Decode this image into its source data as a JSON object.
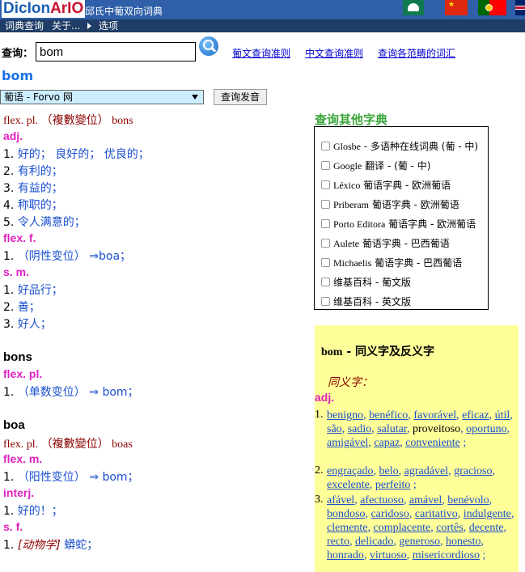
{
  "header": {
    "logo_a": "DicIon",
    "logo_b": "ArIO",
    "site_title": "邱氏中葡双向词典",
    "flags": [
      "macau-flag-icon",
      "china-flag-icon",
      "portugal-flag-icon",
      "uk-flag-icon"
    ],
    "colors": {
      "topbar": "#2e5fa8",
      "menubar": "#1f3d66"
    }
  },
  "menu": {
    "item1": "词典查询",
    "item2": "关于...",
    "item3": "选项"
  },
  "search": {
    "label": "查询：",
    "value": "bom",
    "button_icon": "search-icon",
    "links": [
      "葡文查询准则",
      "中文查询准则",
      "查询各范畴的词汇"
    ]
  },
  "headword": "bom",
  "voice": {
    "select_value": "葡语 - Forvo 网",
    "button": "查询发音"
  },
  "entry1": {
    "flex_pl": "flex. pl.",
    "flex_cn": "（複數變位）",
    "flex_word": "bons",
    "adj": "adj.",
    "adj_senses": [
      {
        "n": "1. ",
        "t": "好的； 良好的； 优良的；"
      },
      {
        "n": "2. ",
        "t": "有利的；"
      },
      {
        "n": "3. ",
        "t": "有益的；"
      },
      {
        "n": "4. ",
        "t": "称职的；"
      },
      {
        "n": "5. ",
        "t": "令人满意的；"
      }
    ],
    "flex_f": "flex. f.",
    "flex_f_sense": {
      "n": "1. ",
      "t": "（阴性变位） ⇒boa；"
    },
    "sm": "s. m.",
    "sm_senses": [
      {
        "n": "1. ",
        "t": "好品行；"
      },
      {
        "n": "2. ",
        "t": "善；"
      },
      {
        "n": "3. ",
        "t": "好人；"
      }
    ]
  },
  "entry2": {
    "word": "bons",
    "pos": "flex. pl.",
    "sense": {
      "n": "1. ",
      "t": "（单数变位） ⇒ bom；"
    }
  },
  "entry3": {
    "word": "boa",
    "flex_pl": "flex. pl.",
    "flex_cn": "（複數變位）",
    "flex_word": "boas",
    "flex_m": "flex. m.",
    "flex_m_sense": {
      "n": "1. ",
      "t": "（阳性变位） ⇒ bom；"
    },
    "interj": "interj.",
    "interj_sense": {
      "n": "1. ",
      "t": "好的！；"
    },
    "sf": "s. f.",
    "sf_sense": {
      "n": "1. ",
      "em": "[动物学]",
      "t": " 蟒蛇；"
    }
  },
  "other_dicts": {
    "title": "查询其他字典",
    "items": [
      {
        "lt": "Glosbe",
        "cn": " - 多语种在线词典 (葡 - 中)"
      },
      {
        "lt": "Google",
        "cn": " 翻译 - (葡 - 中)"
      },
      {
        "lt": "Léxico",
        "cn": " 葡语字典 - 欧洲葡语"
      },
      {
        "lt": "Priberam",
        "cn": " 葡语字典 - 欧洲葡语"
      },
      {
        "lt": "Porto Editora",
        "cn": " 葡语字典 - 欧洲葡语"
      },
      {
        "lt": "Aulete",
        "cn": " 葡语字典 - 巴西葡语"
      },
      {
        "lt": "Michaelis",
        "cn": " 葡语字典 - 巴西葡语"
      },
      {
        "lt": "",
        "cn": "维基百科 - 葡文版"
      },
      {
        "lt": "",
        "cn": "维基百科 - 英文版"
      }
    ]
  },
  "synonyms": {
    "word": "bom",
    "title_rest": " - 同义字及反义字",
    "label": "同义字：",
    "pos": "adj.",
    "groups": [
      {
        "n": "1.",
        "words": [
          "benigno",
          "benéfico",
          "favorável",
          "eficaz",
          "útil",
          "são",
          "sadio",
          "salutar"
        ],
        "plain": "proveitoso",
        "words2": [
          "oportuno",
          "amigável",
          "capaz",
          "conveniente"
        ]
      },
      {
        "n": "2.",
        "words": [
          "engraçado",
          "belo",
          "agradável",
          "gracioso",
          "excelente",
          "perfeito"
        ],
        "plain": "",
        "words2": []
      },
      {
        "n": "3.",
        "words": [
          "afável",
          "afectuoso",
          "amável",
          "benévolo",
          "bondoso",
          "caridoso",
          "caritativo",
          "indulgente",
          "clemente",
          "complacente",
          "cortês",
          "decente",
          "recto",
          "delicado",
          "generoso",
          "honesto",
          "honrado",
          "virtuoso",
          "misericordioso"
        ],
        "plain": "",
        "words2": []
      }
    ]
  }
}
